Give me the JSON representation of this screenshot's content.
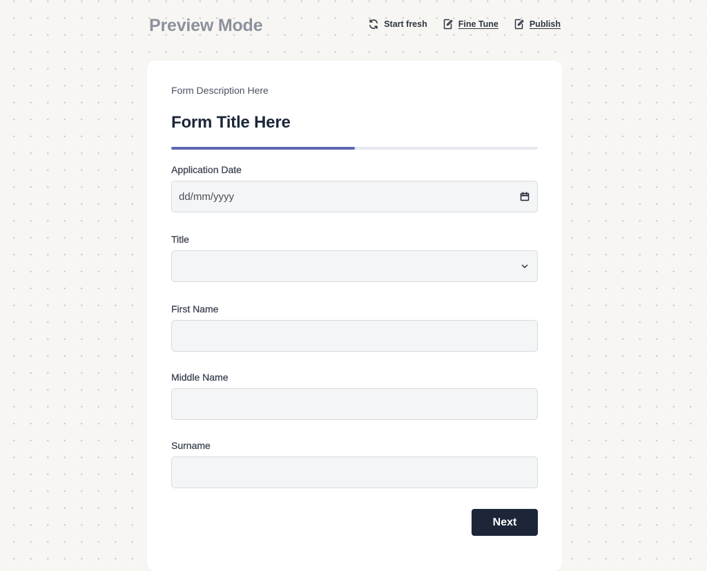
{
  "header": {
    "title": "Preview Mode",
    "actions": [
      {
        "label": "Start fresh",
        "icon": "refresh-icon"
      },
      {
        "label": "Fine Tune",
        "icon": "edit-document-icon"
      },
      {
        "label": "Publish",
        "icon": "edit-document-icon"
      }
    ]
  },
  "form": {
    "description": "Form Description Here",
    "title": "Form Title Here",
    "progress_fraction": 0.5,
    "fields": {
      "application_date": {
        "label": "Application Date",
        "placeholder": "dd/mm/yyyy",
        "value": ""
      },
      "title": {
        "label": "Title",
        "value": ""
      },
      "first_name": {
        "label": "First Name",
        "value": ""
      },
      "middle_name": {
        "label": "Middle Name",
        "value": ""
      },
      "surname": {
        "label": "Surname",
        "value": ""
      }
    },
    "next_label": "Next"
  },
  "colors": {
    "accent": "#5b66b3",
    "button": "#1c2638",
    "page_background": "#f7f6f3",
    "muted_title": "#8c919c"
  }
}
